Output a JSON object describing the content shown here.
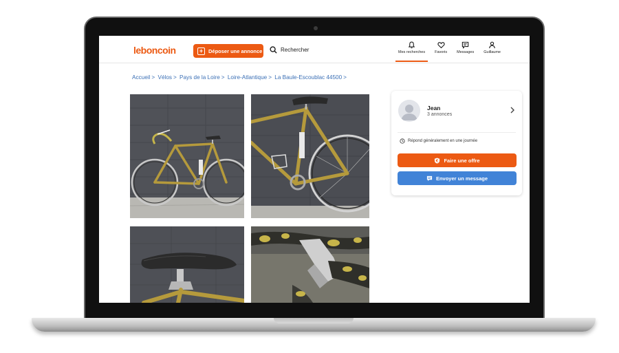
{
  "header": {
    "logo": "leboncoin",
    "post_label": "Déposer une annonce",
    "search_label": "Rechercher",
    "nav": [
      {
        "label": "Mes recherches",
        "icon": "bell-icon",
        "active": true
      },
      {
        "label": "Favoris",
        "icon": "heart-icon",
        "active": false
      },
      {
        "label": "Messages",
        "icon": "chat-icon",
        "active": false
      },
      {
        "label": "Guillaume",
        "icon": "user-icon",
        "active": false
      }
    ]
  },
  "breadcrumb": [
    "Accueil",
    "Vélos",
    "Pays de la Loire",
    "Loire-Atlantique",
    "La Baule-Escoublac 44500"
  ],
  "photos": [
    {
      "name": "bike-full-view"
    },
    {
      "name": "bike-frame-closeup"
    },
    {
      "name": "bike-saddle"
    },
    {
      "name": "bike-handlebar"
    }
  ],
  "seller": {
    "name": "Jean",
    "listings": "3 annonces",
    "response_time": "Répond généralement en une journée",
    "offer_label": "Faire une offre",
    "message_label": "Envoyer un message"
  },
  "colors": {
    "brand": "#ec5a13",
    "link": "#3a6fb5",
    "message_button": "#4183d7"
  }
}
